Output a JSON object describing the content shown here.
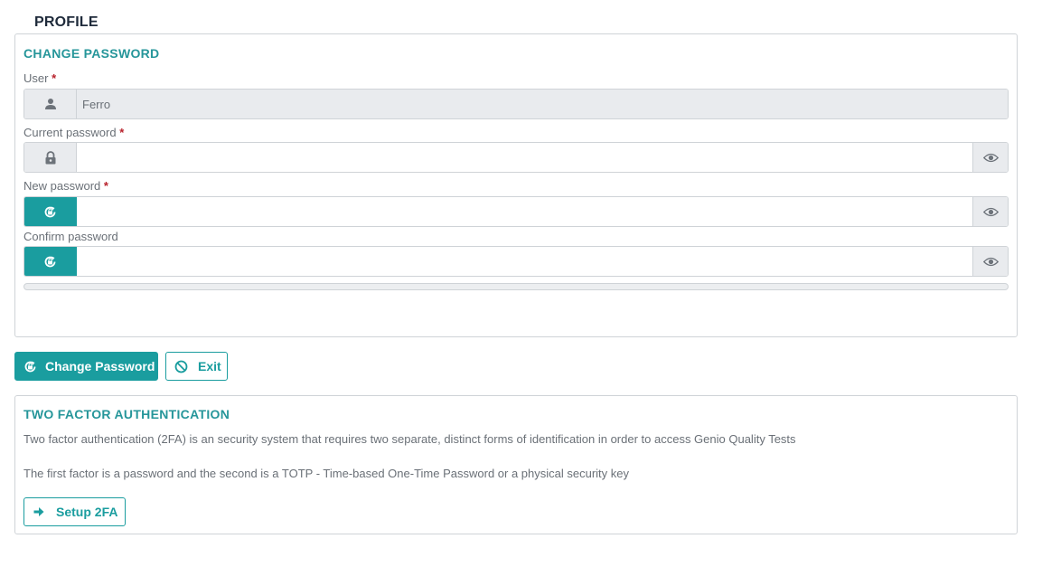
{
  "page": {
    "title": "PROFILE"
  },
  "change_password": {
    "title": "CHANGE PASSWORD",
    "user": {
      "label": "User",
      "required_mark": "*",
      "value": "Ferro"
    },
    "current_password": {
      "label": "Current password",
      "required_mark": "*",
      "value": ""
    },
    "new_password": {
      "label": "New password",
      "required_mark": "*",
      "value": ""
    },
    "confirm_password": {
      "label": "Confirm password",
      "value": ""
    },
    "strength": {
      "level": 0
    }
  },
  "actions": {
    "change_password_label": "Change Password",
    "exit_label": "Exit"
  },
  "two_factor": {
    "title": "TWO FACTOR AUTHENTICATION",
    "description1": "Two factor authentication (2FA) is an security system that requires two separate, distinct forms of identification in order to access Genio Quality Tests",
    "description2": "The first factor is a password and the second is a TOTP - Time-based One-Time Password or a physical security key",
    "setup_label": "Setup 2FA"
  },
  "colors": {
    "accent": "#1a9d9f",
    "required": "#b8222c",
    "title": "#1e2a3a"
  },
  "icons": {
    "user": "user-icon",
    "lock": "lock-icon",
    "reset": "refresh-lock-icon",
    "eye": "eye-icon",
    "ban": "ban-icon",
    "arrow": "arrow-right-icon"
  }
}
